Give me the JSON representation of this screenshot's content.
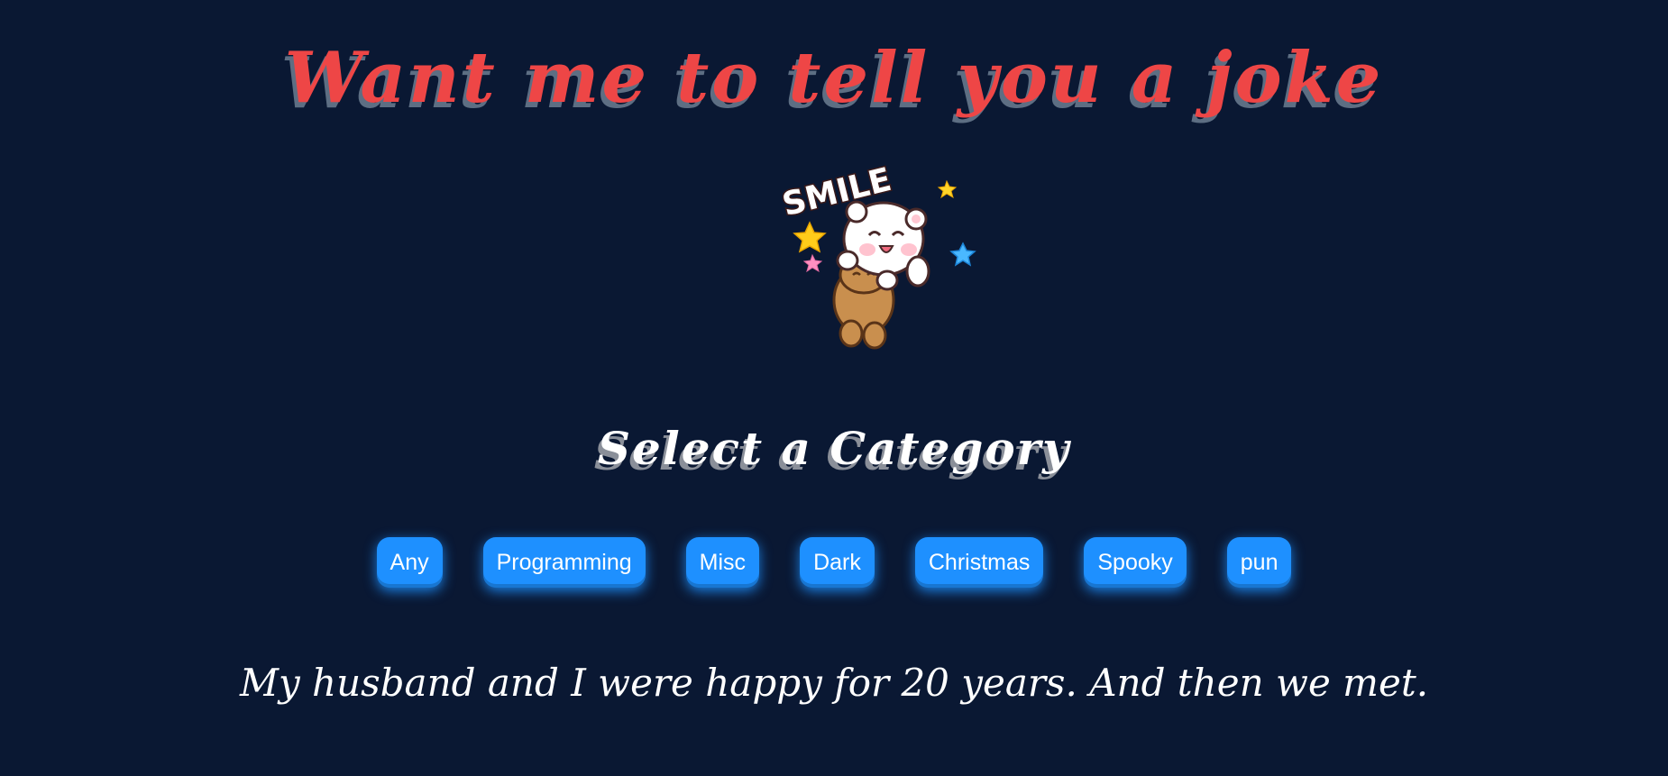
{
  "header": {
    "title": "Want me to tell you a joke"
  },
  "mascot": {
    "icon": "smile-bear-sticker-icon",
    "sticker_text": "SMILE"
  },
  "categories": {
    "heading": "Select a Category",
    "items": [
      {
        "label": "Any"
      },
      {
        "label": "Programming"
      },
      {
        "label": "Misc"
      },
      {
        "label": "Dark"
      },
      {
        "label": "Christmas"
      },
      {
        "label": "Spooky"
      },
      {
        "label": "pun"
      }
    ]
  },
  "joke": {
    "text": "My husband and I were happy for 20 years. And then we met."
  },
  "colors": {
    "background": "#0a1833",
    "title": "#ee4646",
    "button": "#1e90ff"
  }
}
